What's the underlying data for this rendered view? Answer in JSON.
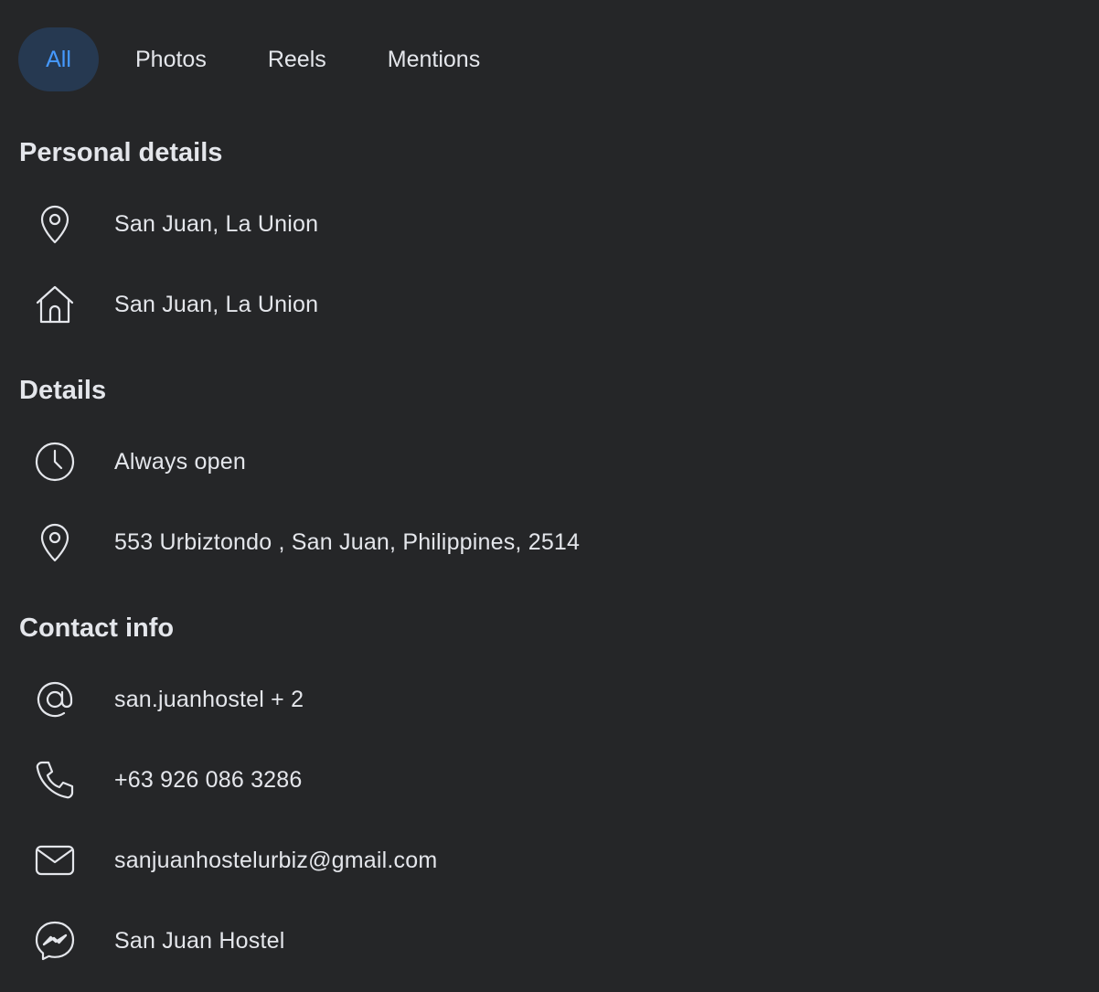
{
  "tabs": [
    {
      "label": "All",
      "active": true
    },
    {
      "label": "Photos",
      "active": false
    },
    {
      "label": "Reels",
      "active": false
    },
    {
      "label": "Mentions",
      "active": false
    }
  ],
  "personal_details": {
    "title": "Personal details",
    "items": [
      {
        "icon": "location-pin-icon",
        "text": "San Juan, La Union"
      },
      {
        "icon": "home-icon",
        "text": "San Juan, La Union"
      }
    ]
  },
  "details": {
    "title": "Details",
    "items": [
      {
        "icon": "clock-icon",
        "text": "Always open"
      },
      {
        "icon": "location-pin-icon",
        "text": "553 Urbiztondo , San Juan, Philippines, 2514"
      }
    ]
  },
  "contact_info": {
    "title": "Contact info",
    "items": [
      {
        "icon": "at-sign-icon",
        "text": "san.juanhostel + 2"
      },
      {
        "icon": "phone-icon",
        "text": "+63 926 086 3286"
      },
      {
        "icon": "mail-icon",
        "text": "sanjuanhostelurbiz@gmail.com"
      },
      {
        "icon": "messenger-icon",
        "text": "San Juan Hostel"
      }
    ]
  },
  "colors": {
    "background": "#252628",
    "text": "#e4e6eb",
    "active_tab_bg": "#263951",
    "active_tab_text": "#4599ff"
  }
}
